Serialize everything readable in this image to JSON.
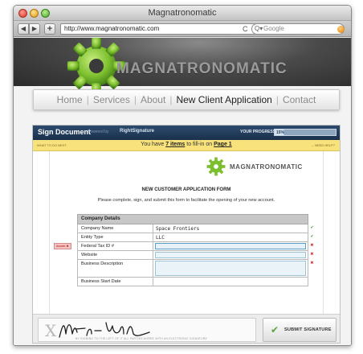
{
  "window": {
    "title": "Magnatronomatic",
    "url": "http://www.magnatronomatic.com",
    "search_placeholder": "Google",
    "back_glyph": "◀",
    "forward_glyph": "▶",
    "add_glyph": "+",
    "reload_glyph": "C",
    "search_glyph": "Q▾"
  },
  "site": {
    "brand": "MAGNATRONOMATIC",
    "nav": [
      {
        "label": "Home"
      },
      {
        "label": "Services"
      },
      {
        "label": "About"
      },
      {
        "label": "New Client Application"
      },
      {
        "label": "Contact"
      }
    ],
    "nav_separator": "|"
  },
  "sign_panel": {
    "title": "Sign Document",
    "powered_by": "Powered by",
    "right_signature": "RightSignature",
    "progress_label": "YOUR PROGRESS",
    "progress_text": "15%",
    "progress_value": 0.15,
    "notice_left": "WHAT TO DO NEXT",
    "notice_prefix": "You have ",
    "notice_items": "7 items",
    "notice_middle": " to fill-in on ",
    "notice_page": "Page 1",
    "notice_right": "→ NEED HELP?"
  },
  "document": {
    "brand": "MAGNATRONOMATIC",
    "title": "NEW CUSTOMER APPLICATION FORM",
    "instructions": "Please complete, sign, and submit this form to facilitate the opening of your new account.",
    "section_header": "Company Details",
    "answer_tab": "Answer ✖",
    "rows": [
      {
        "label": "Company Name",
        "value": "Space Frontiers",
        "mark": "✔"
      },
      {
        "label": "Entity Type",
        "value": "LLC",
        "mark": "✔"
      },
      {
        "label": "Federal Tax ID #",
        "value": "",
        "mark": "✖"
      },
      {
        "label": "Website",
        "value": "",
        "mark": "✖"
      },
      {
        "label": "Business Description",
        "value": "",
        "mark": "✖"
      },
      {
        "label": "Business Start Date",
        "value": "",
        "mark": ""
      }
    ]
  },
  "signature": {
    "x_mark": "X",
    "legal_text": "BY SIGNING TO THE LEFT OF IT ALL PARTIES AGREE WITH AN ELECTRONIC SIGNATURE",
    "submit_label": "SUBMIT SIGNATURE",
    "check_glyph": "✔"
  },
  "colors": {
    "panel_header": "#19304b",
    "notice_bg": "#f7e27b",
    "gear_green": "#7cbf2e",
    "required_mark": "#d42a2a",
    "complete_mark": "#3a9a2a"
  }
}
